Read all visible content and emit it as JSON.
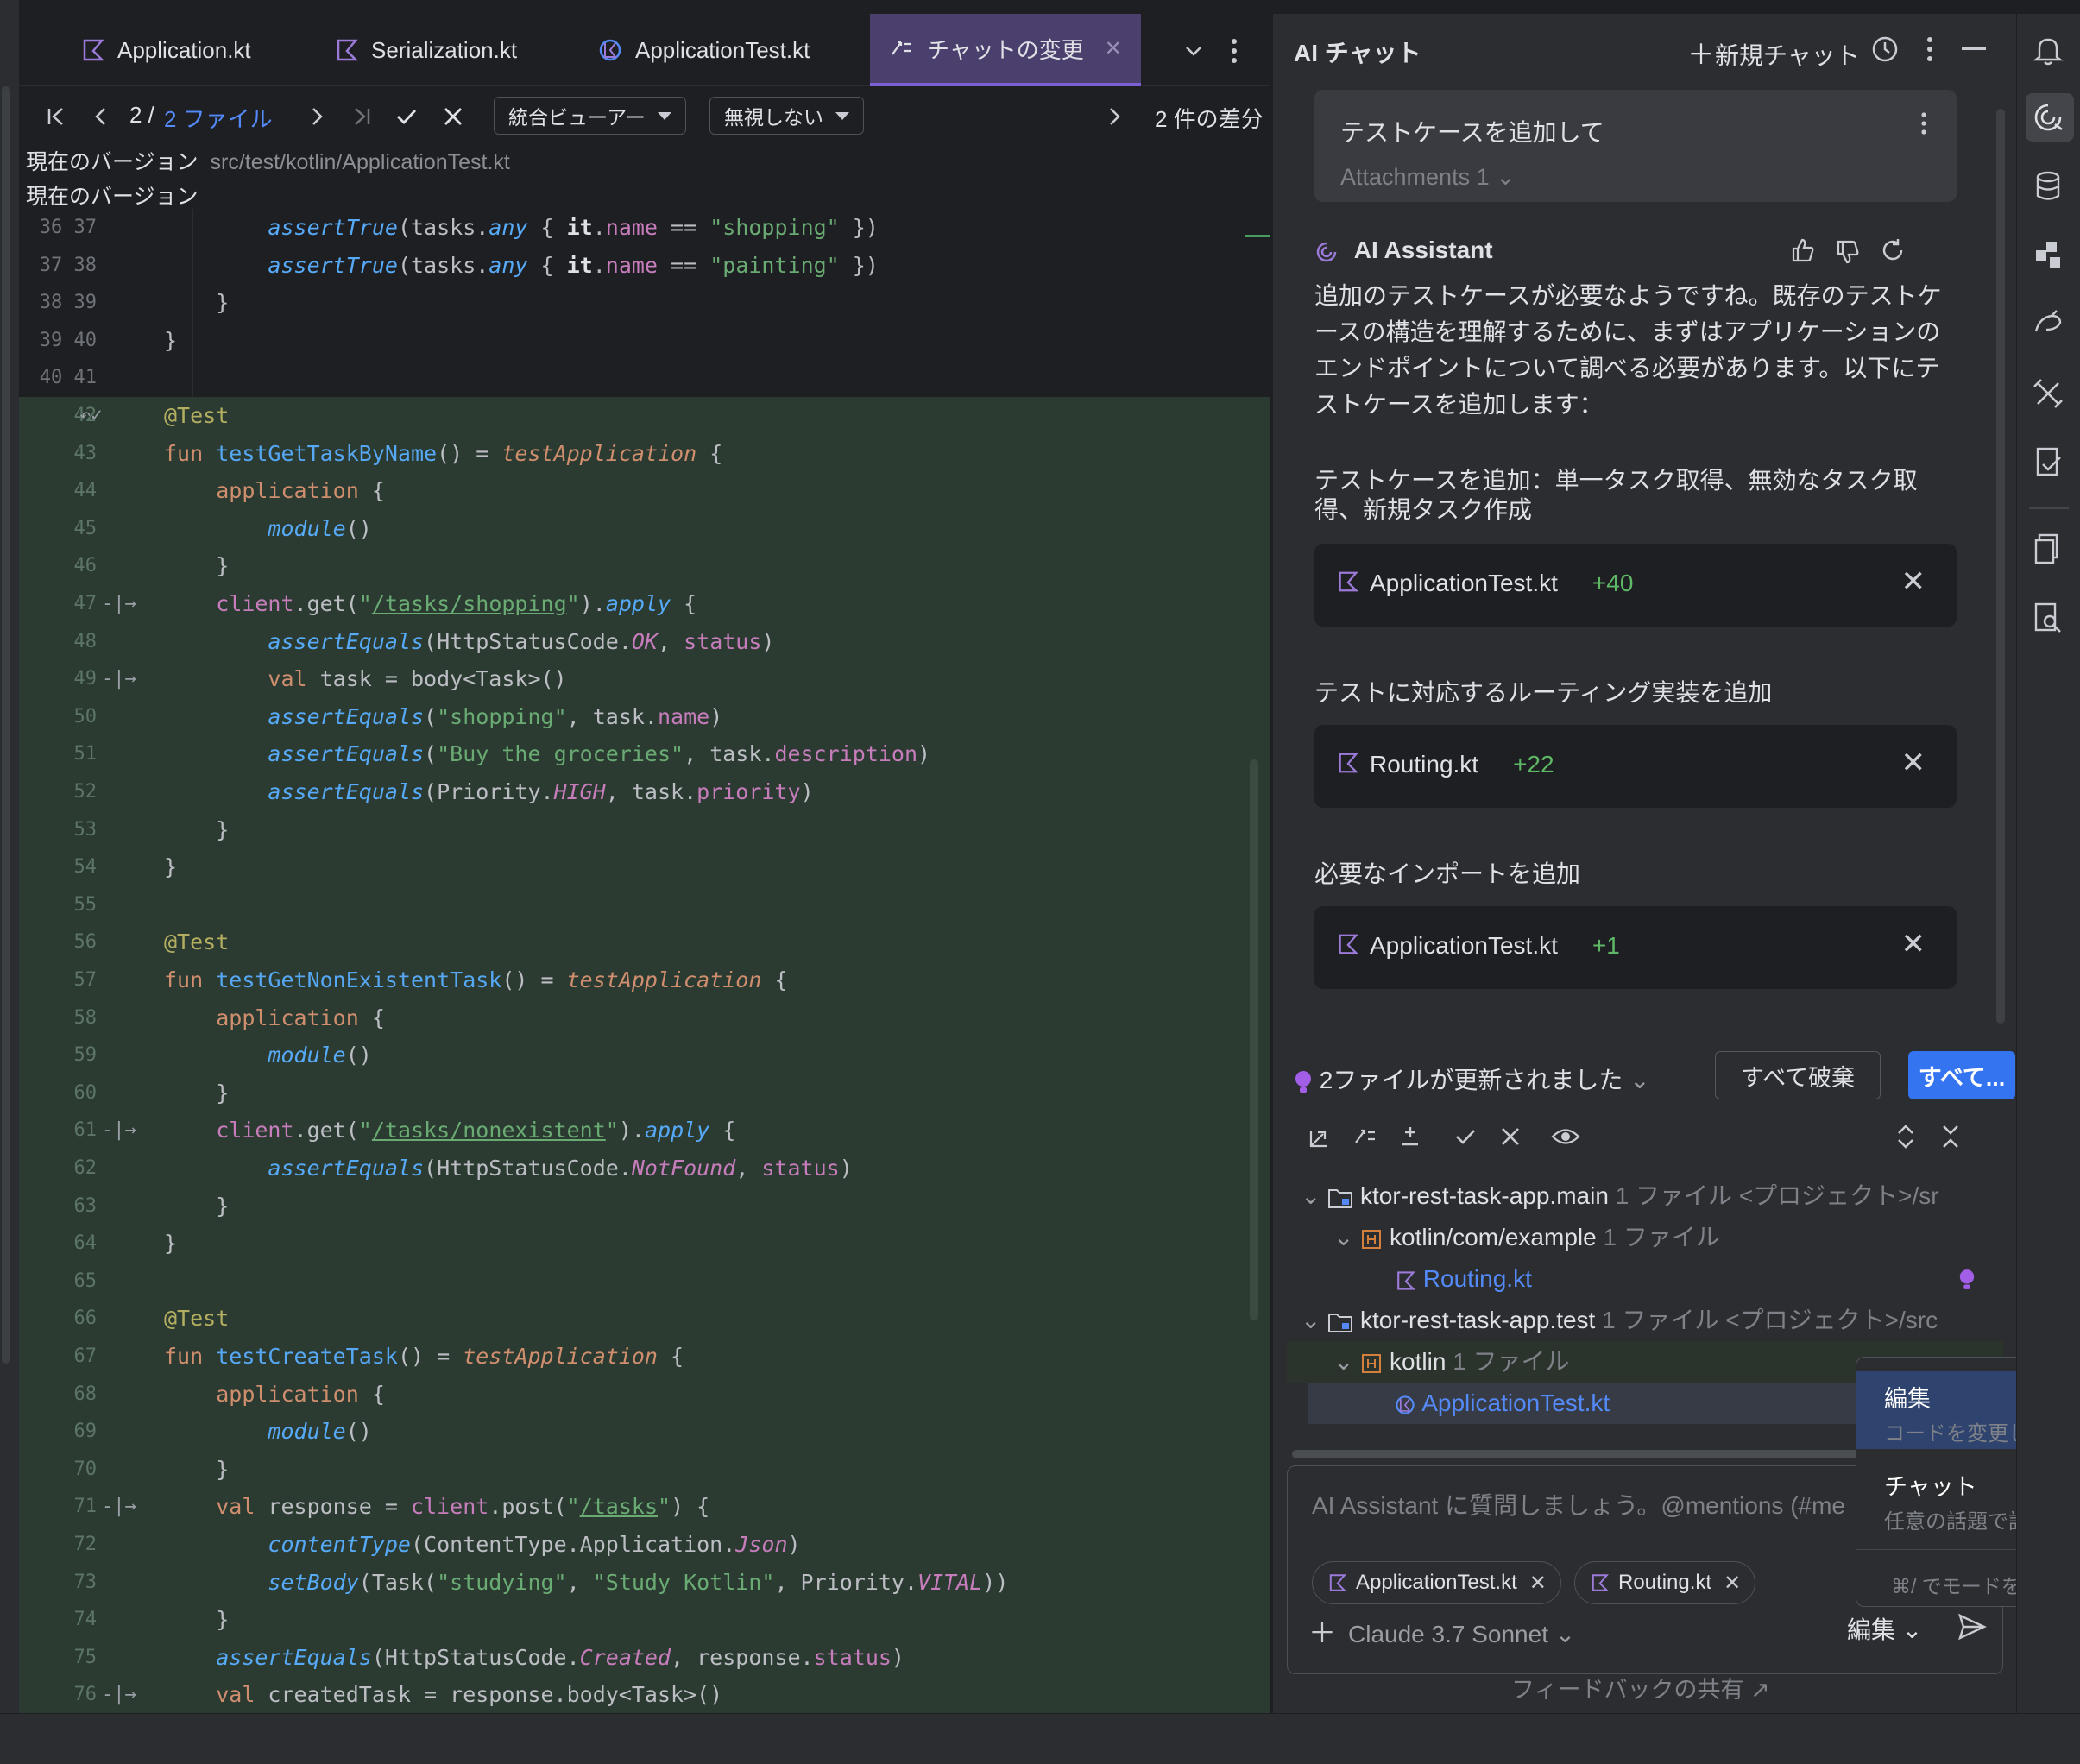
{
  "tabs": [
    {
      "label": "Application.kt",
      "icon": "kotlin-file-icon"
    },
    {
      "label": "Serialization.kt",
      "icon": "kotlin-file-icon"
    },
    {
      "label": "ApplicationTest.kt",
      "icon": "kotlin-test-file-icon"
    },
    {
      "label": "チャットの変更",
      "icon": "diff-icon",
      "active": true
    }
  ],
  "diff_toolbar": {
    "file_counter_current": "2 /",
    "file_counter_total": "2 ファイル",
    "viewer_mode": "統合ビューアー",
    "ignore_mode": "無視しない",
    "diff_count": "2 件の差分"
  },
  "path_row": {
    "label1": "現在のバージョン",
    "path": "src/test/kotlin/ApplicationTest.kt",
    "label2": "現在のバージョン"
  },
  "code_lines": [
    {
      "ln": "36 37",
      "kind": "plain"
    },
    {
      "ln": "37 38",
      "kind": "plain"
    },
    {
      "ln": "38 39",
      "kind": "plain"
    },
    {
      "ln": "39 40",
      "kind": "plain"
    },
    {
      "ln": "40 41",
      "kind": "plain"
    },
    {
      "ln": "42",
      "kind": "added"
    },
    {
      "ln": "43",
      "kind": "added"
    },
    {
      "ln": "44",
      "kind": "added"
    },
    {
      "ln": "45",
      "kind": "added"
    },
    {
      "ln": "46",
      "kind": "added"
    },
    {
      "ln": "47",
      "kind": "added"
    },
    {
      "ln": "48",
      "kind": "added"
    },
    {
      "ln": "49",
      "kind": "added"
    },
    {
      "ln": "50",
      "kind": "added"
    },
    {
      "ln": "51",
      "kind": "added"
    },
    {
      "ln": "52",
      "kind": "added"
    },
    {
      "ln": "53",
      "kind": "added"
    },
    {
      "ln": "54",
      "kind": "added"
    },
    {
      "ln": "55",
      "kind": "added"
    },
    {
      "ln": "56",
      "kind": "added"
    },
    {
      "ln": "57",
      "kind": "added"
    },
    {
      "ln": "58",
      "kind": "added"
    },
    {
      "ln": "59",
      "kind": "added"
    },
    {
      "ln": "60",
      "kind": "added"
    },
    {
      "ln": "61",
      "kind": "added"
    },
    {
      "ln": "62",
      "kind": "added"
    },
    {
      "ln": "63",
      "kind": "added"
    },
    {
      "ln": "64",
      "kind": "added"
    },
    {
      "ln": "65",
      "kind": "added"
    },
    {
      "ln": "66",
      "kind": "added"
    },
    {
      "ln": "67",
      "kind": "added"
    },
    {
      "ln": "68",
      "kind": "added"
    },
    {
      "ln": "69",
      "kind": "added"
    },
    {
      "ln": "70",
      "kind": "added"
    },
    {
      "ln": "71",
      "kind": "added"
    },
    {
      "ln": "72",
      "kind": "added"
    },
    {
      "ln": "73",
      "kind": "added"
    },
    {
      "ln": "74",
      "kind": "added"
    },
    {
      "ln": "75",
      "kind": "added"
    },
    {
      "ln": "76",
      "kind": "added"
    }
  ],
  "code_text": [
    "        assertTrue(tasks.any { it.name == \"shopping\" })",
    "        assertTrue(tasks.any { it.name == \"painting\" })",
    "    }",
    "}",
    "",
    "@Test",
    "fun testGetTaskByName() = testApplication {",
    "    application {",
    "        module()",
    "    }",
    "    client.get(\"/tasks/shopping\").apply {",
    "        assertEquals(HttpStatusCode.OK, status)",
    "        val task = body<Task>()",
    "        assertEquals(\"shopping\", task.name)",
    "        assertEquals(\"Buy the groceries\", task.description)",
    "        assertEquals(Priority.HIGH, task.priority)",
    "    }",
    "}",
    "",
    "@Test",
    "fun testGetNonExistentTask() = testApplication {",
    "    application {",
    "        module()",
    "    }",
    "    client.get(\"/tasks/nonexistent\").apply {",
    "        assertEquals(HttpStatusCode.NotFound, status)",
    "    }",
    "}",
    "",
    "@Test",
    "fun testCreateTask() = testApplication {",
    "    application {",
    "        module()",
    "    }",
    "    val response = client.post(\"/tasks\") {",
    "        contentType(ContentType.Application.Json)",
    "        setBody(Task(\"studying\", \"Study Kotlin\", Priority.VITAL))",
    "    }",
    "    assertEquals(HttpStatusCode.Created, response.status)",
    "    val createdTask = response.body<Task>()"
  ],
  "chat": {
    "title": "AI チャット",
    "new_chat": "新規チャット",
    "user_message": "テストケースを追加して",
    "attachments": "Attachments 1",
    "assistant_name": "AI Assistant",
    "assistant_text": "追加のテストケースが必要なようですね。既存のテストケースの構造を理解するために、まずはアプリケーションのエンドポイントについて調べる必要があります。以下にテストケースを追加します：",
    "sections": [
      {
        "title": "テストケースを追加：単一タスク取得、無効なタスク取得、新規タスク作成",
        "file": "ApplicationTest.kt",
        "delta": "+40"
      },
      {
        "title": "テストに対応するルーティング実装を追加",
        "file": "Routing.kt",
        "delta": "+22"
      },
      {
        "title": "必要なインポートを追加",
        "file": "ApplicationTest.kt",
        "delta": "+1"
      }
    ],
    "files_updated": "2ファイルが更新されました",
    "discard_all": "すべて破棄",
    "accept_all": "すべて...",
    "tree": {
      "main_module": "ktor-rest-task-app.main",
      "main_module_meta": "1 ファイル  <プロジェクト>/sr",
      "main_pkg": "kotlin/com/example",
      "main_pkg_meta": "1 ファイル",
      "main_file": "Routing.kt",
      "test_module": "ktor-rest-task-app.test",
      "test_module_meta": "1 ファイル  <プロジェクト>/src",
      "test_pkg": "kotlin",
      "test_pkg_meta": "1 ファイル",
      "test_file": "ApplicationTest.kt"
    },
    "input_placeholder": "AI Assistant に質問しましょう。@mentions (#me",
    "chips": [
      "ApplicationTest.kt",
      "Routing.kt"
    ],
    "model": "Claude 3.7 Sonnet",
    "mode": "編集",
    "feedback": "フィードバックの共有 ↗"
  },
  "mode_popup": {
    "items": [
      {
        "title": "編集",
        "desc": "コードを変更します",
        "selected": true
      },
      {
        "title": "チャット",
        "desc": "任意の話題で話します",
        "selected": false
      }
    ],
    "hint": "⌘/ でモードを切り替"
  },
  "colors": {
    "accent": "#3574f0",
    "added_bg": "#2b3b32",
    "active_tab": "#4b3f6e",
    "added_delta": "#5fb865"
  }
}
